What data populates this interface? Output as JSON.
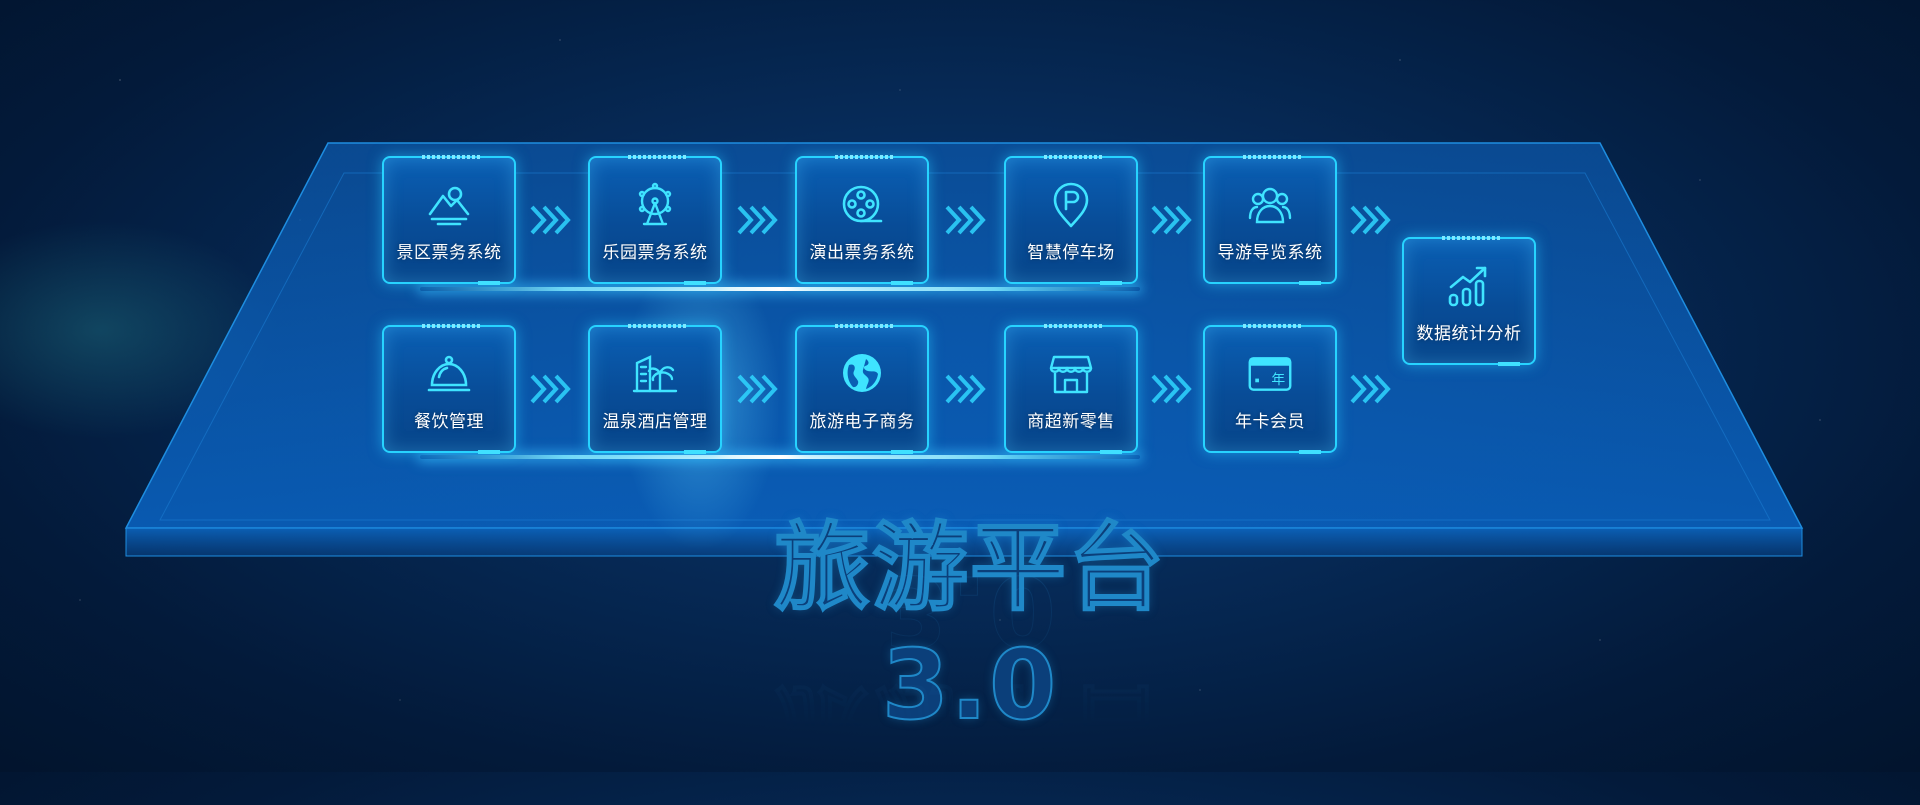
{
  "title": "旅游平台3.0",
  "rows": [
    [
      {
        "label": "景区票务系统",
        "icon": "mountain-icon"
      },
      {
        "label": "乐园票务系统",
        "icon": "ferris-wheel-icon"
      },
      {
        "label": "演出票务系统",
        "icon": "film-reel-icon"
      },
      {
        "label": "智慧停车场",
        "icon": "parking-pin-icon"
      },
      {
        "label": "导游导览系统",
        "icon": "people-group-icon"
      }
    ],
    [
      {
        "label": "餐饮管理",
        "icon": "cloche-icon"
      },
      {
        "label": "温泉酒店管理",
        "icon": "hotel-palm-icon"
      },
      {
        "label": "旅游电子商务",
        "icon": "globe-icon"
      },
      {
        "label": "商超新零售",
        "icon": "storefront-icon"
      },
      {
        "label": "年卡会员",
        "icon": "year-card-icon"
      }
    ]
  ],
  "side_node": {
    "label": "数据统计分析",
    "icon": "bar-growth-icon"
  },
  "card_icon_text": "年",
  "colors": {
    "accent": "#27d3ff",
    "tile": "#0a5fb4",
    "background": "#031a3a"
  }
}
